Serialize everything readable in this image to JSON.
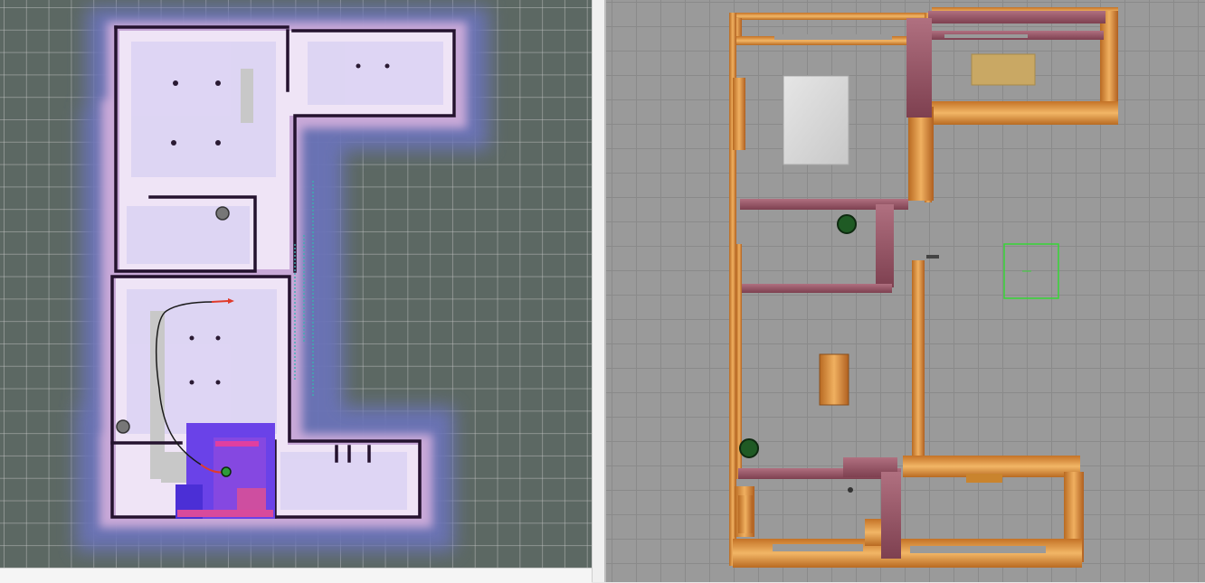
{
  "windows": {
    "left": {
      "name": "rviz-map-view"
    },
    "right": {
      "name": "gazebo-simulation-view"
    }
  },
  "colors": {
    "rviz_background": "#5c6863",
    "costmap_outer": "#6b73b8",
    "costmap_inner": "#c9bdf0",
    "free_space": "#f2e6f5",
    "wall": "#2a1a33",
    "robot_path": "#1a1a1a",
    "goal_arrow": "#e03a2a",
    "local_costmap": "#5b2ee0",
    "gazebo_ground": "#9a9a9a",
    "wood": "#d68a3c",
    "brick": "#a06070",
    "tree": "#1f5a24",
    "target_marker": "#36d636"
  },
  "icons": {
    "robot": "robot-icon",
    "goal": "goal-arrow-icon",
    "target": "target-square-icon"
  }
}
